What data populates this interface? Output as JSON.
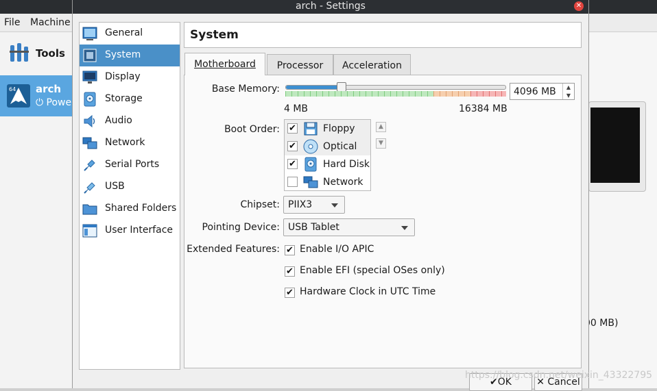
{
  "background": {
    "menu": [
      "File",
      "Machine"
    ],
    "tools_label": "Tools",
    "vm": {
      "name": "arch",
      "state": "Powe"
    },
    "right_info": "00 MB)",
    "watermark": "https://blog.csdn.net/weixin_43322795"
  },
  "dialog": {
    "title": "arch - Settings",
    "sidebar": [
      {
        "label": "General",
        "icon": "general-icon"
      },
      {
        "label": "System",
        "icon": "system-icon",
        "selected": true
      },
      {
        "label": "Display",
        "icon": "display-icon"
      },
      {
        "label": "Storage",
        "icon": "storage-icon"
      },
      {
        "label": "Audio",
        "icon": "audio-icon"
      },
      {
        "label": "Network",
        "icon": "network-icon"
      },
      {
        "label": "Serial Ports",
        "icon": "serial-ports-icon"
      },
      {
        "label": "USB",
        "icon": "usb-icon"
      },
      {
        "label": "Shared Folders",
        "icon": "shared-folders-icon"
      },
      {
        "label": "User Interface",
        "icon": "user-interface-icon"
      }
    ],
    "page_title": "System",
    "tabs": [
      {
        "label": "Motherboard",
        "active": true
      },
      {
        "label": "Processor"
      },
      {
        "label": "Acceleration"
      }
    ],
    "motherboard": {
      "base_memory_label": "Base Memory:",
      "memory_value": "4096 MB",
      "memory_min": "4 MB",
      "memory_max": "16384 MB",
      "memory_fraction": 0.25,
      "boot_order_label": "Boot Order:",
      "boot_order": [
        {
          "label": "Floppy",
          "checked": true,
          "icon": "floppy-icon"
        },
        {
          "label": "Optical",
          "checked": true,
          "icon": "optical-disc-icon"
        },
        {
          "label": "Hard Disk",
          "checked": true,
          "icon": "hard-disk-icon"
        },
        {
          "label": "Network",
          "checked": false,
          "icon": "network-icon"
        }
      ],
      "chipset_label": "Chipset:",
      "chipset_value": "PIIX3",
      "pointing_label": "Pointing Device:",
      "pointing_value": "USB Tablet",
      "extended_label": "Extended Features:",
      "features": [
        {
          "label": "Enable I/O APIC",
          "checked": true
        },
        {
          "label": "Enable EFI (special OSes only)",
          "checked": true
        },
        {
          "label": "Hardware Clock in UTC Time",
          "checked": true
        }
      ]
    },
    "ok_label": "OK",
    "cancel_label": "Cancel"
  },
  "colors": {
    "selection": "#4a90c8",
    "titlebar": "#2c2f33",
    "close_button": "#e0443e"
  }
}
